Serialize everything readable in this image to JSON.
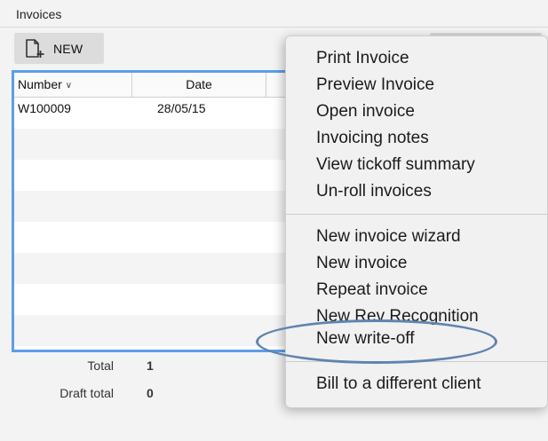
{
  "panel": {
    "title": "Invoices"
  },
  "toolbar": {
    "new_icon": "new-document-icon",
    "new_label": "NEW"
  },
  "list": {
    "columns": {
      "number": "Number",
      "date": "Date"
    },
    "sort_icon": "chevron-down-icon",
    "rows": [
      {
        "number": "W100009",
        "date": "28/05/15"
      },
      {
        "number": "",
        "date": ""
      },
      {
        "number": "",
        "date": ""
      },
      {
        "number": "",
        "date": ""
      },
      {
        "number": "",
        "date": ""
      },
      {
        "number": "",
        "date": ""
      },
      {
        "number": "",
        "date": ""
      },
      {
        "number": "",
        "date": ""
      }
    ]
  },
  "totals": {
    "total_label": "Total",
    "total_value": "1",
    "draft_label": "Draft total",
    "draft_value": "0"
  },
  "context_menu": {
    "group1": [
      "Print Invoice",
      "Preview Invoice",
      "Open invoice",
      "Invoicing notes",
      "View tickoff summary",
      "Un-roll invoices"
    ],
    "group2": [
      "New invoice wizard",
      "New invoice",
      "Repeat invoice",
      "New Rev Recognition",
      "New write-off"
    ],
    "group3": [
      "Bill to a different client"
    ]
  },
  "colors": {
    "selection_border": "#5c9ee8",
    "annotation_ellipse": "#5f84b0"
  }
}
